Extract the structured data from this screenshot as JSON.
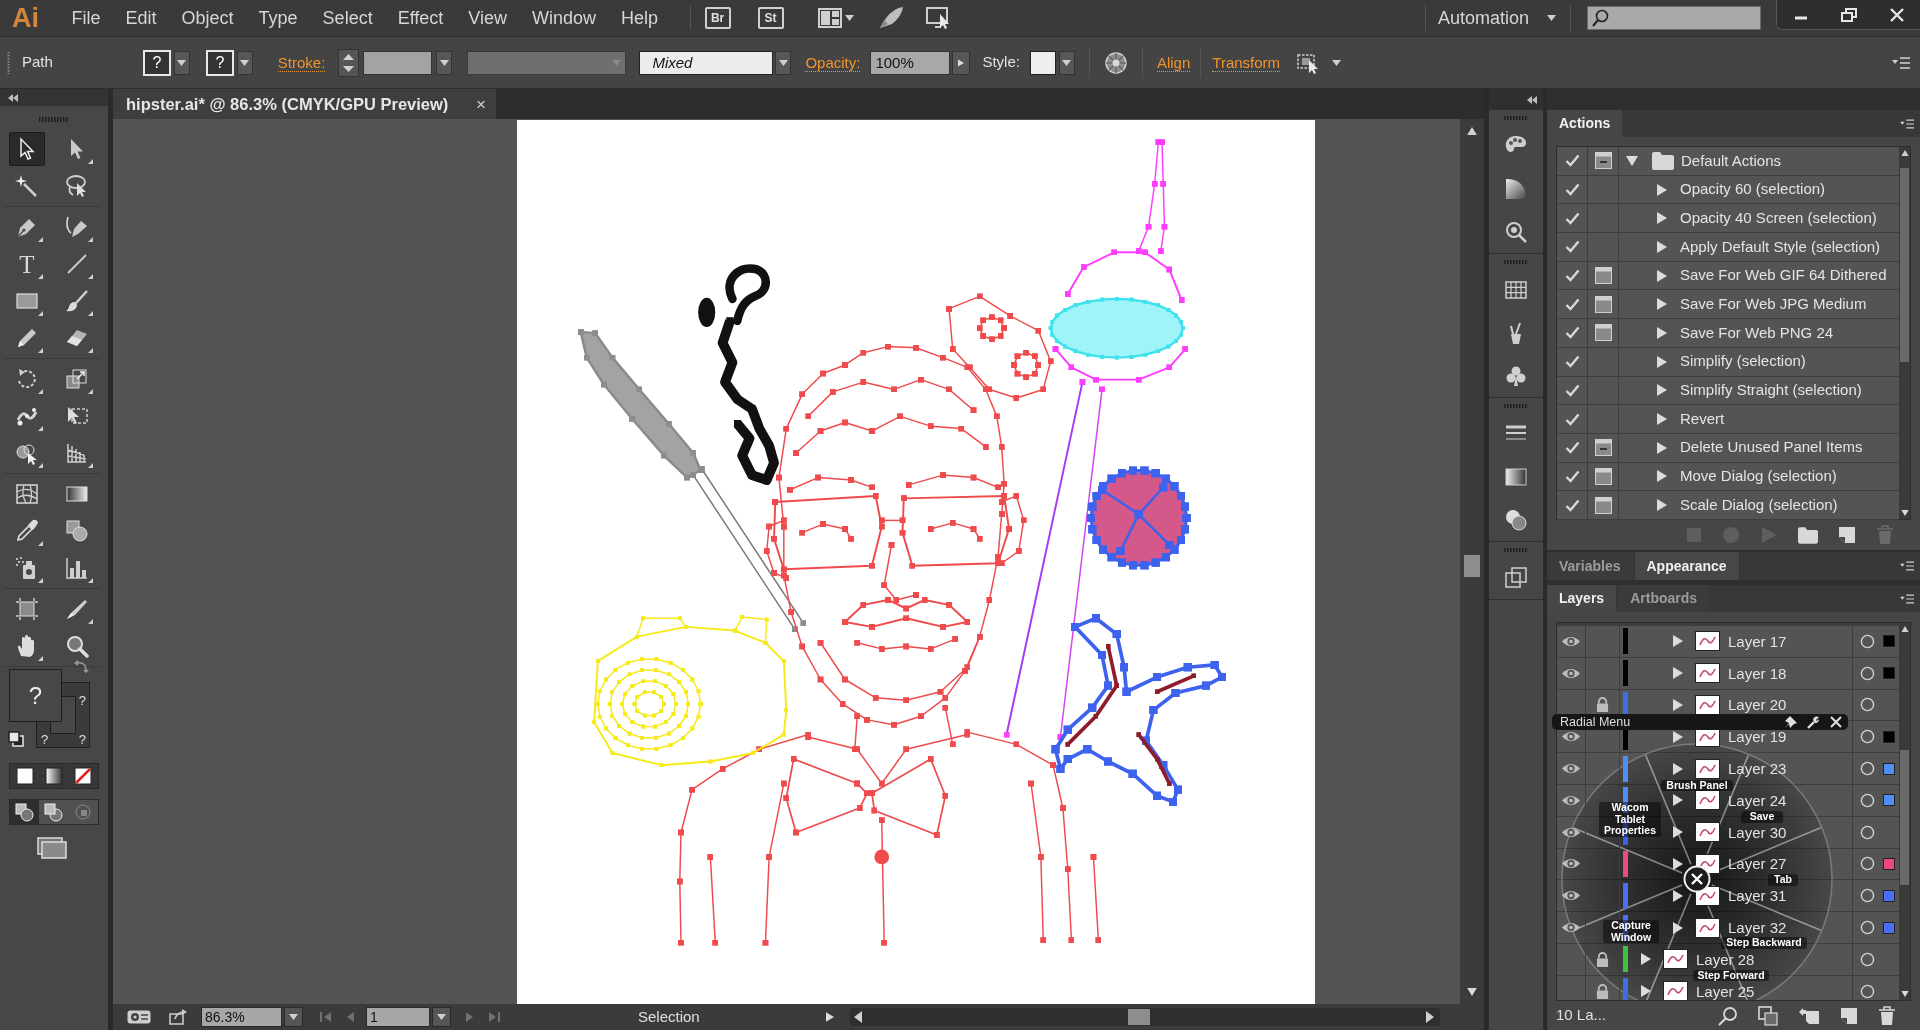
{
  "app": {
    "logo": "Ai",
    "menu": [
      "File",
      "Edit",
      "Object",
      "Type",
      "Select",
      "Effect",
      "View",
      "Window",
      "Help"
    ],
    "bridge_buttons": [
      "Br",
      "St"
    ],
    "workspace": "Automation"
  },
  "control_bar": {
    "selection": "Path",
    "fill": "?",
    "stroke": "?",
    "stroke_label": "Stroke:",
    "brush": "Mixed",
    "opacity_label": "Opacity:",
    "opacity": "100%",
    "style_label": "Style:",
    "links": [
      "Align",
      "Transform"
    ]
  },
  "document_tab": {
    "title": "hipster.ai* @ 86.3% (CMYK/GPU Preview)",
    "close": "×"
  },
  "toolbar": {
    "tools": [
      {
        "kind": "selection",
        "selected": true,
        "flyout": false
      },
      {
        "kind": "direct-selection",
        "selected": false,
        "flyout": true
      },
      {
        "kind": "magic-wand",
        "selected": false,
        "flyout": false
      },
      {
        "kind": "lasso",
        "selected": false,
        "flyout": false
      },
      {
        "kind": "pen",
        "selected": false,
        "flyout": true
      },
      {
        "kind": "curvature",
        "selected": false,
        "flyout": true
      },
      {
        "kind": "type",
        "glyph": "T",
        "selected": false,
        "flyout": true
      },
      {
        "kind": "line",
        "selected": false,
        "flyout": true
      },
      {
        "kind": "rectangle",
        "selected": false,
        "flyout": true
      },
      {
        "kind": "paintbrush",
        "selected": false,
        "flyout": true
      },
      {
        "kind": "pencil",
        "selected": false,
        "flyout": true
      },
      {
        "kind": "eraser",
        "selected": false,
        "flyout": true
      },
      {
        "kind": "rotate",
        "selected": false,
        "flyout": true
      },
      {
        "kind": "scale",
        "selected": false,
        "flyout": true
      },
      {
        "kind": "puppet-warp",
        "selected": false,
        "flyout": true
      },
      {
        "kind": "free-transform",
        "selected": false,
        "flyout": false
      },
      {
        "kind": "shape-builder",
        "selected": false,
        "flyout": true
      },
      {
        "kind": "perspective-grid",
        "selected": false,
        "flyout": true
      },
      {
        "kind": "mesh",
        "selected": false,
        "flyout": false
      },
      {
        "kind": "gradient",
        "selected": false,
        "flyout": false
      },
      {
        "kind": "eyedropper",
        "selected": false,
        "flyout": true
      },
      {
        "kind": "blend",
        "selected": false,
        "flyout": false
      },
      {
        "kind": "symbol-sprayer",
        "selected": false,
        "flyout": true
      },
      {
        "kind": "column-graph",
        "selected": false,
        "flyout": true
      },
      {
        "kind": "artboard",
        "selected": false,
        "flyout": false
      },
      {
        "kind": "slice",
        "selected": false,
        "flyout": true
      },
      {
        "kind": "hand",
        "selected": false,
        "flyout": true
      },
      {
        "kind": "zoom",
        "selected": false,
        "flyout": false
      }
    ],
    "fill_box": "?",
    "stroke_box": [
      "?",
      "?",
      "?"
    ],
    "draw_modes": [
      {
        "kind": "normal",
        "selected": true,
        "disabled": false
      },
      {
        "kind": "behind",
        "selected": false,
        "disabled": false
      },
      {
        "kind": "inside",
        "selected": false,
        "disabled": true
      }
    ]
  },
  "actions_panel": {
    "tab": "Actions",
    "rows": [
      {
        "label": "Default Actions",
        "kind": "set",
        "checked": true,
        "dialog": true,
        "mixed": true,
        "expanded": true
      },
      {
        "label": "Opacity 60 (selection)",
        "kind": "action",
        "checked": true,
        "dialog": false,
        "expanded": false
      },
      {
        "label": "Opacity 40 Screen (selection)",
        "kind": "action",
        "checked": true,
        "dialog": false,
        "expanded": false
      },
      {
        "label": "Apply Default Style (selection)",
        "kind": "action",
        "checked": true,
        "dialog": false,
        "expanded": false
      },
      {
        "label": "Save For Web GIF 64 Dithered",
        "kind": "action",
        "checked": true,
        "dialog": true,
        "mixed": false,
        "expanded": false
      },
      {
        "label": "Save For Web JPG Medium",
        "kind": "action",
        "checked": true,
        "dialog": true,
        "mixed": false,
        "expanded": false
      },
      {
        "label": "Save For Web PNG 24",
        "kind": "action",
        "checked": true,
        "dialog": true,
        "mixed": false,
        "expanded": false
      },
      {
        "label": "Simplify (selection)",
        "kind": "action",
        "checked": true,
        "dialog": false,
        "expanded": false
      },
      {
        "label": "Simplify Straight (selection)",
        "kind": "action",
        "checked": true,
        "dialog": false,
        "expanded": false
      },
      {
        "label": "Revert",
        "kind": "action",
        "checked": true,
        "dialog": false,
        "expanded": false
      },
      {
        "label": "Delete Unused Panel Items",
        "kind": "action",
        "checked": true,
        "dialog": true,
        "mixed": true,
        "expanded": false
      },
      {
        "label": "Move Dialog (selection)",
        "kind": "action",
        "checked": true,
        "dialog": true,
        "mixed": false,
        "expanded": false
      },
      {
        "label": "Scale Dialog (selection)",
        "kind": "action",
        "checked": true,
        "dialog": true,
        "mixed": false,
        "expanded": false
      }
    ]
  },
  "panel_tabs": [
    {
      "label": "Variables",
      "selected": false
    },
    {
      "label": "Appearance",
      "selected": true
    }
  ],
  "layers_panel": {
    "tabs": [
      {
        "label": "Layers",
        "selected": true
      },
      {
        "label": "Artboards",
        "selected": false
      }
    ],
    "layers": [
      {
        "children": [
          {
            "name": "Layer 17",
            "visible": true,
            "locked": false,
            "expanded": false,
            "color": "#000000",
            "has_selection": true
          },
          {
            "name": "Layer 18",
            "visible": true,
            "locked": false,
            "expanded": false,
            "color": "#000000",
            "has_selection": true
          },
          {
            "name": "Layer 20",
            "visible": false,
            "locked": true,
            "expanded": false,
            "color": "#3d6ee8",
            "has_selection": false
          },
          {
            "name": "Layer 19",
            "visible": true,
            "locked": false,
            "expanded": false,
            "color": "#000000",
            "has_selection": true
          },
          {
            "name": "Layer 23",
            "visible": true,
            "locked": false,
            "expanded": false,
            "color": "#4f8ef7",
            "has_selection": true
          },
          {
            "name": "Layer 24",
            "visible": true,
            "locked": false,
            "expanded": false,
            "color": "#4f8ef7",
            "has_selection": true
          },
          {
            "name": "Layer 30",
            "visible": true,
            "locked": false,
            "expanded": false,
            "color": "#3d5fe6",
            "has_selection": false
          },
          {
            "name": "Layer 27",
            "visible": true,
            "locked": false,
            "expanded": false,
            "color": "#f04878",
            "has_selection": true
          },
          {
            "name": "Layer 31",
            "visible": true,
            "locked": false,
            "expanded": false,
            "color": "#4a6ef5",
            "has_selection": true
          },
          {
            "name": "Layer 32",
            "visible": true,
            "locked": false,
            "expanded": false,
            "color": "#4a6ef5",
            "has_selection": true
          }
        ]
      },
      {
        "name": "Layer 28",
        "visible": false,
        "locked": true,
        "expanded": false,
        "color": "#3fc23f",
        "has_selection": false
      },
      {
        "name": "Layer 25",
        "visible": false,
        "locked": true,
        "expanded": false,
        "color": "#3d6ee8",
        "has_selection": false
      }
    ],
    "count": "10 La..."
  },
  "radial_menu": {
    "title": "Radial Menu",
    "items": [
      "Brush Panel",
      "Wacom Tablet Properties",
      "Save",
      "Tab",
      "Capture Window",
      "Step Backward",
      "Step Forward"
    ]
  },
  "status_bar": {
    "zoom": "86.3%",
    "artboard": "1",
    "tool": "Selection"
  }
}
